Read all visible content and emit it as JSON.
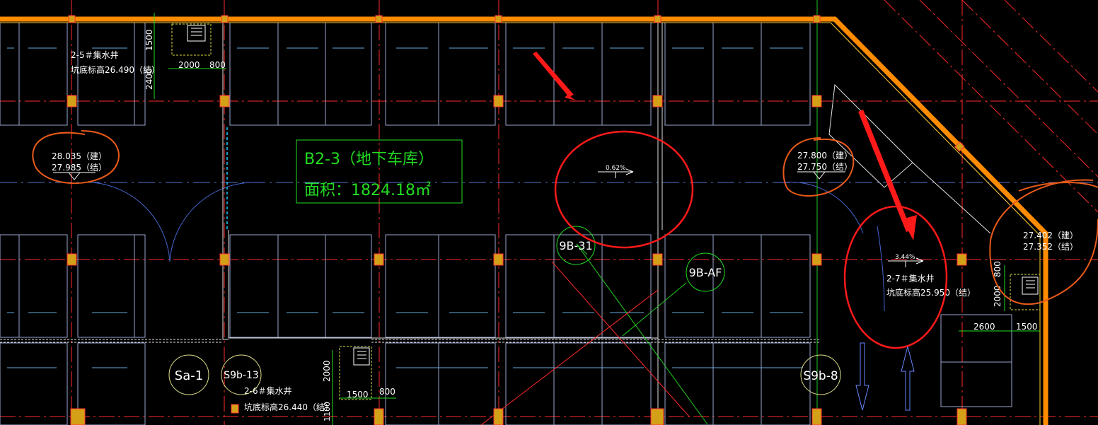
{
  "drawing": {
    "room_name": "B2-3（地下车库）",
    "room_area": "面积：1824.18㎡",
    "sumps": [
      {
        "name": "2-5＃集水井",
        "pit_level": "坑底标高26.490（结）",
        "dims": [
          "2000",
          "800"
        ],
        "vdims": [
          "1500",
          "2400"
        ]
      },
      {
        "name": "2-6＃集水井",
        "pit_level": "坑底标高26.440（结）",
        "dims": [
          "1500",
          "800"
        ],
        "vdims": [
          "2000",
          "1100"
        ]
      },
      {
        "name": "2-7＃集水井",
        "pit_level": "坑底标高25.950（结）",
        "dims": [
          "2600",
          "1500"
        ],
        "vdims": [
          "800",
          "2000"
        ]
      }
    ],
    "elevations": [
      {
        "arch": "28.035（建）",
        "struct": "27.985（结）"
      },
      {
        "arch": "27.800（建）",
        "struct": "27.750（结）"
      },
      {
        "arch": "27.402（建）",
        "struct": "27.352（结）"
      }
    ],
    "slopes": [
      "0.62%",
      "3.44%"
    ],
    "axis_tags": [
      "9B-31",
      "9B-AF",
      "Sa-1",
      "S9b-13",
      "S9b-8"
    ],
    "colors": {
      "background": "#000000",
      "grid_axis": "#ff2a2a",
      "wall": "#ff8c00",
      "parking": "#9aa6d0",
      "annotation": "#ff1a1a",
      "room_text": "#22dd22",
      "white_text": "#ffffff",
      "column": "#d4a017"
    }
  }
}
